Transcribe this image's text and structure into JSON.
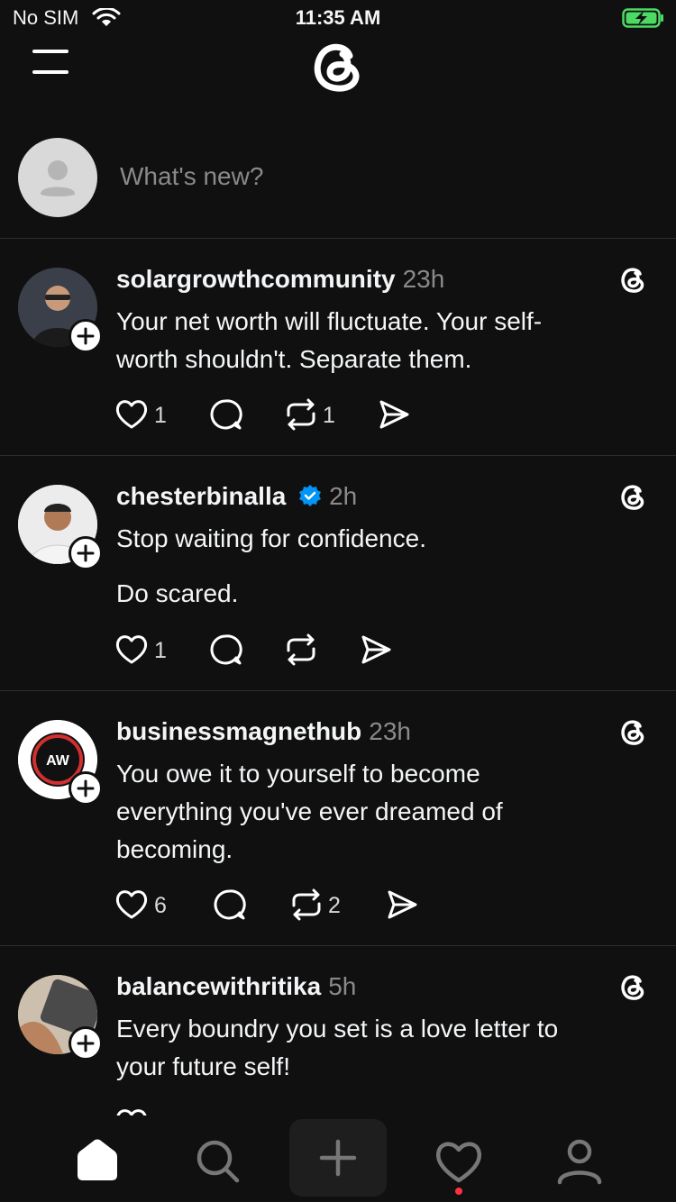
{
  "status_bar": {
    "carrier": "No SIM",
    "time": "11:35 AM"
  },
  "composer": {
    "placeholder": "What's new?"
  },
  "posts": [
    {
      "username": "solargrowthcommunity",
      "verified": false,
      "time": "23h",
      "text": [
        "Your net worth will fluctuate. Your self-",
        "worth shouldn't. Separate them."
      ],
      "likes": "1",
      "replies": "",
      "reposts": "1"
    },
    {
      "username": "chesterbinalla",
      "verified": true,
      "time": "2h",
      "text": [
        "Stop waiting for confidence.",
        "",
        "Do scared."
      ],
      "likes": "1",
      "replies": "",
      "reposts": ""
    },
    {
      "username": "businessmagnethub",
      "verified": false,
      "time": "23h",
      "text": [
        "You owe it to yourself to become",
        "everything you've ever dreamed of",
        "becoming."
      ],
      "likes": "6",
      "replies": "",
      "reposts": "2"
    },
    {
      "username": "balancewithritika",
      "verified": false,
      "time": "5h",
      "text": [
        "Every boundry you set is a love letter to",
        "your future self!"
      ],
      "likes": "",
      "replies": "",
      "reposts": ""
    }
  ],
  "bottom_nav": {
    "items": [
      "home-icon",
      "search-icon",
      "compose-icon",
      "heart-icon",
      "profile-icon"
    ],
    "active": "home-icon",
    "notification_dot": true
  },
  "colors": {
    "background": "#101010",
    "text": "#f3f5f7",
    "muted": "#8a8a8a",
    "verified": "#0095f6",
    "battery": "#4cd964",
    "notification": "#ff3040"
  }
}
